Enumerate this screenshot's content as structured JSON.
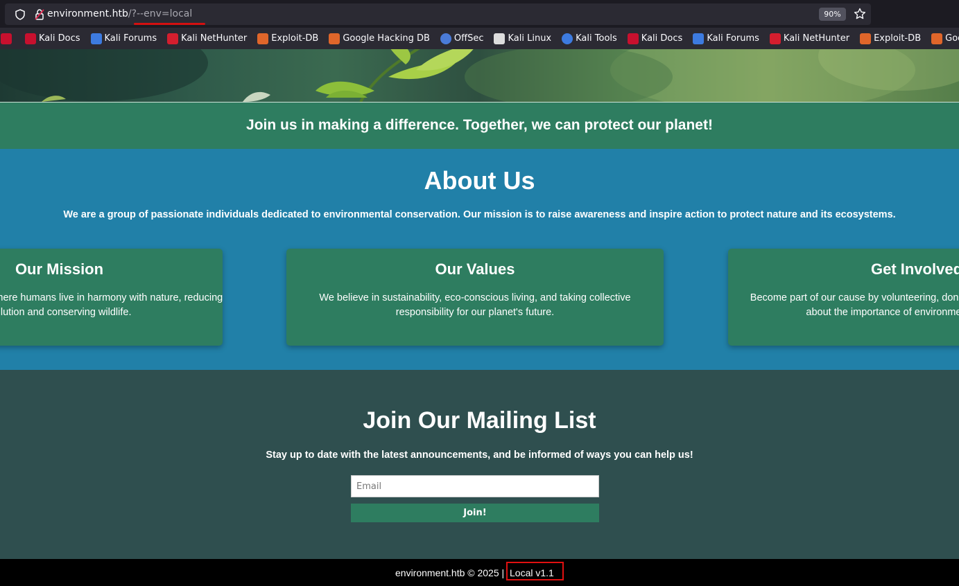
{
  "browser": {
    "url_host": "environment.htb",
    "url_rest": "/?--env=local",
    "zoom": "90%",
    "icons": {
      "shield": "shield-icon",
      "lock": "lock-slash-icon",
      "star": "star-icon"
    },
    "bookmarks": [
      {
        "label": "",
        "icon": "kali-docs-icon",
        "color": "#c8102e"
      },
      {
        "label": "Kali Docs",
        "icon": "kali-docs-icon",
        "color": "#c8102e"
      },
      {
        "label": "Kali Forums",
        "icon": "kali-forums-icon",
        "color": "#3d7be0"
      },
      {
        "label": "Kali NetHunter",
        "icon": "nethunter-icon",
        "color": "#d41e2e"
      },
      {
        "label": "Exploit-DB",
        "icon": "exploitdb-icon",
        "color": "#e0662a"
      },
      {
        "label": "Google Hacking DB",
        "icon": "ghdb-icon",
        "color": "#e0662a"
      },
      {
        "label": "OffSec",
        "icon": "offsec-icon",
        "color": "#4a7bd8"
      },
      {
        "label": "Kali Linux",
        "icon": "kali-dragon-icon",
        "color": "#dddddd"
      },
      {
        "label": "Kali Tools",
        "icon": "kali-tools-icon",
        "color": "#3d7be0"
      },
      {
        "label": "Kali Docs",
        "icon": "kali-docs-icon",
        "color": "#c8102e"
      },
      {
        "label": "Kali Forums",
        "icon": "kali-forums-icon",
        "color": "#3d7be0"
      },
      {
        "label": "Kali NetHunter",
        "icon": "nethunter-icon",
        "color": "#d41e2e"
      },
      {
        "label": "Exploit-DB",
        "icon": "exploitdb-icon",
        "color": "#e0662a"
      },
      {
        "label": "Google Hacking DB",
        "icon": "ghdb-icon",
        "color": "#e0662a"
      }
    ]
  },
  "banner": {
    "text": "Join us in making a difference. Together, we can protect our planet!"
  },
  "about": {
    "title": "About Us",
    "description": "We are a group of passionate individuals dedicated to environmental conservation. Our mission is to raise awareness and inspire action to protect nature and its ecosystems.",
    "cards": [
      {
        "title": "Our Mission",
        "line1": "We strive for a world where humans live in harmony with nature, reducing",
        "line2": "pollution and conserving wildlife."
      },
      {
        "title": "Our Values",
        "line1": "We believe in sustainability, eco-conscious living, and taking collective",
        "line2": "responsibility for our planet's future."
      },
      {
        "title": "Get Involved",
        "line1": "Become part of our cause by volunteering, donating, or spreading the word",
        "line2": "about the importance of environmental protection."
      }
    ]
  },
  "mailing": {
    "title": "Join Our Mailing List",
    "description": "Stay up to date with the latest announcements, and be informed of ways you can help us!",
    "email_placeholder": "Email",
    "button_label": "Join!"
  },
  "footer": {
    "copyright": "environment.htb © 2025 |",
    "version": "Local v1.1"
  },
  "colors": {
    "banner_green": "#2e7d60",
    "about_blue": "#2180a8",
    "mailing_bg": "#2f4f4f",
    "highlight_red": "#e01010"
  }
}
